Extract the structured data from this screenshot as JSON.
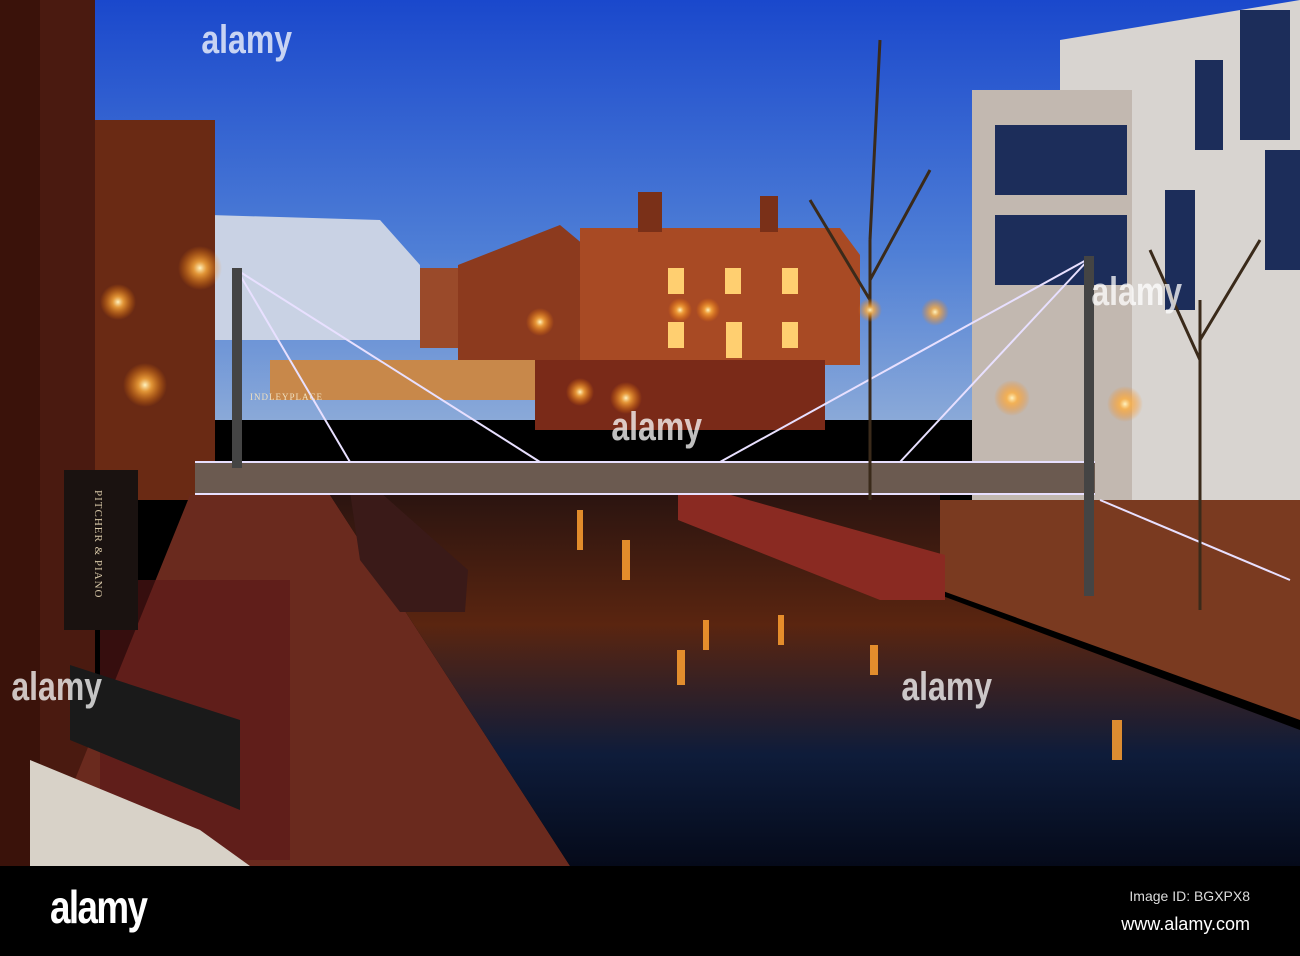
{
  "footer": {
    "logo": "alamy",
    "image_id": "Image ID: BGXPX8",
    "website": "www.alamy.com"
  },
  "watermark": "alamy",
  "scene": {
    "sign_restaurant": "PITCHER & PIANO",
    "sign_bridge": "INDLEYPLACE"
  },
  "colors": {
    "sky_top": "#1d4fd0",
    "sky_bottom": "#7fa6e0",
    "brick": "#8a3a1e",
    "light": "#ffb347",
    "water": "#0a1530"
  }
}
